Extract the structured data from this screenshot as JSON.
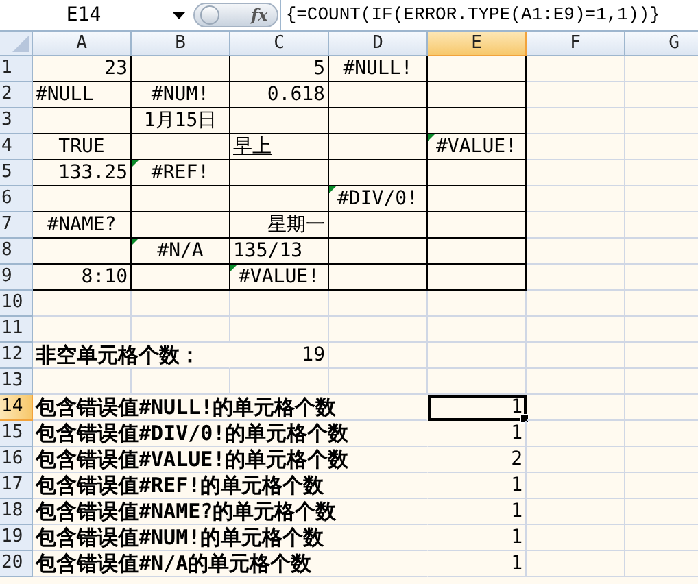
{
  "name_box": "E14",
  "function_label": "fx",
  "formula": "{=COUNT(IF(ERROR.TYPE(A1:E9)=1,1))}",
  "columns": [
    {
      "label": "A",
      "selected": false
    },
    {
      "label": "B",
      "selected": false
    },
    {
      "label": "C",
      "selected": false
    },
    {
      "label": "D",
      "selected": false
    },
    {
      "label": "E",
      "selected": true
    },
    {
      "label": "F",
      "selected": false
    },
    {
      "label": "G",
      "selected": false
    }
  ],
  "rows": [
    {
      "label": "1",
      "selected": false,
      "cells": [
        {
          "text": "23",
          "kind": "number",
          "boxed": true
        },
        {
          "boxed": true
        },
        {
          "text": "5",
          "kind": "number",
          "boxed": true
        },
        {
          "text": "#NULL!",
          "kind": "centered",
          "boxed": true
        },
        {
          "boxed": true
        },
        null,
        null
      ]
    },
    {
      "label": "2",
      "selected": false,
      "cells": [
        {
          "text": "#NULL",
          "kind": "text",
          "boxed": true
        },
        {
          "text": "#NUM!",
          "kind": "centered",
          "boxed": true
        },
        {
          "text": "0.618",
          "kind": "number",
          "boxed": true
        },
        {
          "boxed": true
        },
        {
          "boxed": true
        },
        null,
        null
      ]
    },
    {
      "label": "3",
      "selected": false,
      "cells": [
        {
          "boxed": true
        },
        {
          "text": "1月15日",
          "kind": "centered",
          "boxed": true
        },
        {
          "boxed": true
        },
        {
          "boxed": true
        },
        {
          "boxed": true
        },
        null,
        null
      ]
    },
    {
      "label": "4",
      "selected": false,
      "cells": [
        {
          "text": "TRUE",
          "kind": "centered",
          "boxed": true
        },
        {
          "boxed": true
        },
        {
          "text": "早上",
          "kind": "text",
          "boxed": true,
          "underline": true
        },
        {
          "boxed": true
        },
        {
          "text": "#VALUE!",
          "kind": "centered",
          "boxed": true,
          "error_flag": true
        },
        null,
        null
      ]
    },
    {
      "label": "5",
      "selected": false,
      "cells": [
        {
          "text": "133.25",
          "kind": "number",
          "boxed": true
        },
        {
          "text": "#REF!",
          "kind": "centered",
          "boxed": true,
          "error_flag": true
        },
        {
          "boxed": true
        },
        {
          "boxed": true
        },
        {
          "boxed": true
        },
        null,
        null
      ]
    },
    {
      "label": "6",
      "selected": false,
      "cells": [
        {
          "boxed": true
        },
        {
          "boxed": true
        },
        {
          "boxed": true
        },
        {
          "text": "#DIV/0!",
          "kind": "centered",
          "boxed": true,
          "error_flag": true
        },
        {
          "boxed": true
        },
        null,
        null
      ]
    },
    {
      "label": "7",
      "selected": false,
      "cells": [
        {
          "text": "#NAME?",
          "kind": "centered",
          "boxed": true
        },
        {
          "boxed": true
        },
        {
          "text": "星期一",
          "kind": "number",
          "boxed": true
        },
        {
          "boxed": true
        },
        {
          "boxed": true
        },
        null,
        null
      ]
    },
    {
      "label": "8",
      "selected": false,
      "cells": [
        {
          "boxed": true
        },
        {
          "text": "#N/A",
          "kind": "centered",
          "boxed": true,
          "error_flag": true
        },
        {
          "text": "135/13",
          "kind": "text",
          "boxed": true
        },
        {
          "boxed": true
        },
        {
          "boxed": true
        },
        null,
        null
      ]
    },
    {
      "label": "9",
      "selected": false,
      "cells": [
        {
          "text": "8:10",
          "kind": "number",
          "boxed": true
        },
        {
          "boxed": true
        },
        {
          "text": "#VALUE!",
          "kind": "centered",
          "boxed": true,
          "error_flag": true
        },
        {
          "boxed": true
        },
        {
          "boxed": true
        },
        null,
        null
      ]
    },
    {
      "label": "10",
      "selected": false,
      "cells": [
        null,
        null,
        null,
        null,
        null,
        null,
        null
      ]
    },
    {
      "label": "11",
      "selected": false,
      "cells": [
        null,
        null,
        null,
        null,
        null,
        null,
        null
      ]
    },
    {
      "label": "12",
      "selected": false,
      "cells": [
        {
          "text": "非空单元格个数：",
          "kind": "label"
        },
        null,
        {
          "text": "19",
          "kind": "number"
        },
        null,
        null,
        null,
        null
      ]
    },
    {
      "label": "13",
      "selected": false,
      "cells": [
        null,
        null,
        null,
        null,
        null,
        null,
        null
      ]
    },
    {
      "label": "14",
      "selected": true,
      "cells": [
        {
          "text": "包含错误值#NULL!的单元格个数",
          "kind": "label"
        },
        null,
        null,
        null,
        {
          "text": "1",
          "kind": "number",
          "selected": true
        },
        null,
        null
      ]
    },
    {
      "label": "15",
      "selected": false,
      "cells": [
        {
          "text": "包含错误值#DIV/0!的单元格个数",
          "kind": "label"
        },
        null,
        null,
        null,
        {
          "text": "1",
          "kind": "number",
          "selected": false
        },
        null,
        null
      ]
    },
    {
      "label": "16",
      "selected": false,
      "cells": [
        {
          "text": "包含错误值#VALUE!的单元格个数",
          "kind": "label"
        },
        null,
        null,
        null,
        {
          "text": "2",
          "kind": "number",
          "selected": false
        },
        null,
        null
      ]
    },
    {
      "label": "17",
      "selected": false,
      "cells": [
        {
          "text": "包含错误值#REF!的单元格个数",
          "kind": "label"
        },
        null,
        null,
        null,
        {
          "text": "1",
          "kind": "number",
          "selected": false
        },
        null,
        null
      ]
    },
    {
      "label": "18",
      "selected": false,
      "cells": [
        {
          "text": "包含错误值#NAME?的单元格个数",
          "kind": "label"
        },
        null,
        null,
        null,
        {
          "text": "1",
          "kind": "number",
          "selected": false
        },
        null,
        null
      ]
    },
    {
      "label": "19",
      "selected": false,
      "cells": [
        {
          "text": "包含错误值#NUM!的单元格个数",
          "kind": "label"
        },
        null,
        null,
        null,
        {
          "text": "1",
          "kind": "number",
          "selected": false
        },
        null,
        null
      ]
    },
    {
      "label": "20",
      "selected": false,
      "cells": [
        {
          "text": "包含错误值#N/A的单元格个数",
          "kind": "label"
        },
        null,
        null,
        null,
        {
          "text": "1",
          "kind": "number",
          "selected": false
        },
        null,
        null
      ]
    }
  ]
}
